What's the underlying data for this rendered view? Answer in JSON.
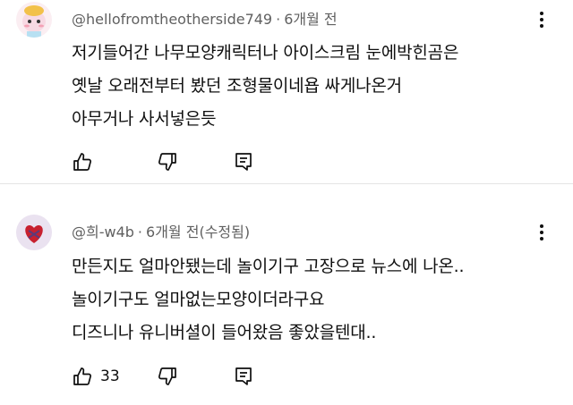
{
  "comments": [
    {
      "author": "@hellofromtheotherside749",
      "age": "6개월 전",
      "edited": "",
      "lines": [
        "저기들어간 나무모양캐릭터나 아이스크림 눈에박힌곰은",
        "옛날 오래전부터 봤던 조형물이네욥 싸게나온거",
        "아무거나 사서넣은듯"
      ],
      "like_count": "",
      "avatar_color": "#f3c6d8"
    },
    {
      "author": "@희-w4b",
      "age": "6개월 전",
      "edited": "(수정됨)",
      "lines": [
        "만든지도 얼마안됐는데 놀이기구 고장으로 뉴스에 나온..",
        "놀이기구도 얼마없는모양이더라구요",
        "디즈니나 유니버셜이 들어왔음 좋았을텐대.."
      ],
      "like_count": "33",
      "avatar_color": "#5b3a7a"
    }
  ],
  "icons": {
    "like": "thumbs-up-icon",
    "dislike": "thumbs-down-icon",
    "reply": "reply-icon",
    "more": "more-vert-icon"
  }
}
